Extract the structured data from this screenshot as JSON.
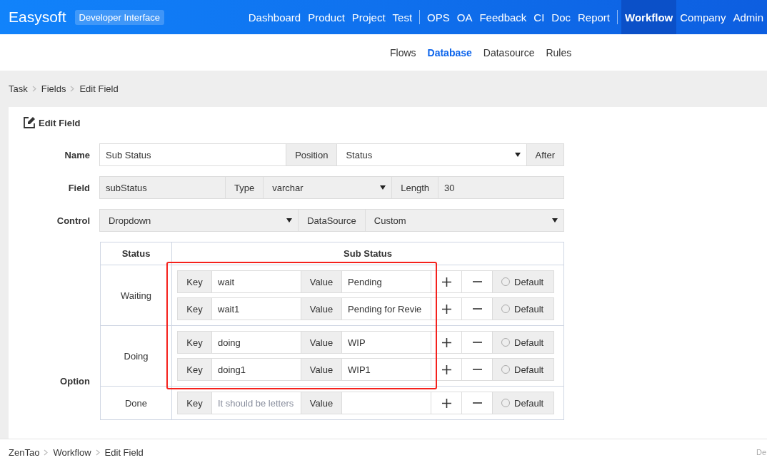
{
  "header": {
    "brand": "Easysoft",
    "badge": "Developer Interface",
    "nav": [
      {
        "label": "Dashboard",
        "selected": false,
        "separator_after": false
      },
      {
        "label": "Product",
        "selected": false,
        "separator_after": false
      },
      {
        "label": "Project",
        "selected": false,
        "separator_after": false
      },
      {
        "label": "Test",
        "selected": false,
        "separator_after": true
      },
      {
        "label": "OPS",
        "selected": false,
        "separator_after": false
      },
      {
        "label": "OA",
        "selected": false,
        "separator_after": false
      },
      {
        "label": "Feedback",
        "selected": false,
        "separator_after": false
      },
      {
        "label": "CI",
        "selected": false,
        "separator_after": false
      },
      {
        "label": "Doc",
        "selected": false,
        "separator_after": false
      },
      {
        "label": "Report",
        "selected": false,
        "separator_after": true
      },
      {
        "label": "Workflow",
        "selected": true,
        "separator_after": false
      },
      {
        "label": "Company",
        "selected": false,
        "separator_after": false
      },
      {
        "label": "Admin",
        "selected": false,
        "separator_after": false
      }
    ]
  },
  "subnav": [
    {
      "label": "Flows",
      "selected": false
    },
    {
      "label": "Database",
      "selected": true
    },
    {
      "label": "Datasource",
      "selected": false
    },
    {
      "label": "Rules",
      "selected": false
    }
  ],
  "breadcrumb": [
    "Task",
    "Fields",
    "Edit Field"
  ],
  "card": {
    "title": "Edit Field",
    "rows": [
      {
        "label": "Name",
        "parts": [
          {
            "kind": "input",
            "value": "Sub Status",
            "disabled": false
          },
          {
            "kind": "addon",
            "text": "Position"
          },
          {
            "kind": "select",
            "value": "Status",
            "disabled": false
          },
          {
            "kind": "addon",
            "text": "After"
          }
        ]
      },
      {
        "label": "Field",
        "parts": [
          {
            "kind": "input",
            "value": "subStatus",
            "disabled": true
          },
          {
            "kind": "addon",
            "text": "Type"
          },
          {
            "kind": "select",
            "value": "varchar",
            "disabled": true
          },
          {
            "kind": "addon",
            "text": "Length"
          },
          {
            "kind": "input",
            "value": "30",
            "disabled": true
          }
        ]
      },
      {
        "label": "Control",
        "parts": [
          {
            "kind": "select",
            "value": "Dropdown",
            "disabled": true
          },
          {
            "kind": "addon",
            "text": "DataSource"
          },
          {
            "kind": "select",
            "value": "Custom",
            "disabled": true
          }
        ]
      }
    ],
    "option": {
      "label": "Option",
      "columns": [
        "Status",
        "Sub Status"
      ],
      "highlight_frame": true,
      "groups": [
        {
          "status": "Waiting",
          "items": [
            {
              "key_label": "Key",
              "key": "wait",
              "value_label": "Value",
              "value": "Pending",
              "default_label": "Default",
              "default": false
            },
            {
              "key_label": "Key",
              "key": "wait1",
              "value_label": "Value",
              "value": "Pending for Revie",
              "default_label": "Default",
              "default": false
            }
          ]
        },
        {
          "status": "Doing",
          "items": [
            {
              "key_label": "Key",
              "key": "doing",
              "value_label": "Value",
              "value": "WIP",
              "default_label": "Default",
              "default": false
            },
            {
              "key_label": "Key",
              "key": "doing1",
              "value_label": "Value",
              "value": "WIP1",
              "default_label": "Default",
              "default": false
            }
          ]
        },
        {
          "status": "Done",
          "items": [
            {
              "key_label": "Key",
              "key_placeholder": "It should be letters",
              "value_label": "Value",
              "default_label": "Default",
              "default": false
            }
          ]
        }
      ]
    }
  },
  "footer": {
    "breadcrumb": [
      "ZenTao",
      "Workflow",
      "Edit Field"
    ],
    "right": "De"
  }
}
